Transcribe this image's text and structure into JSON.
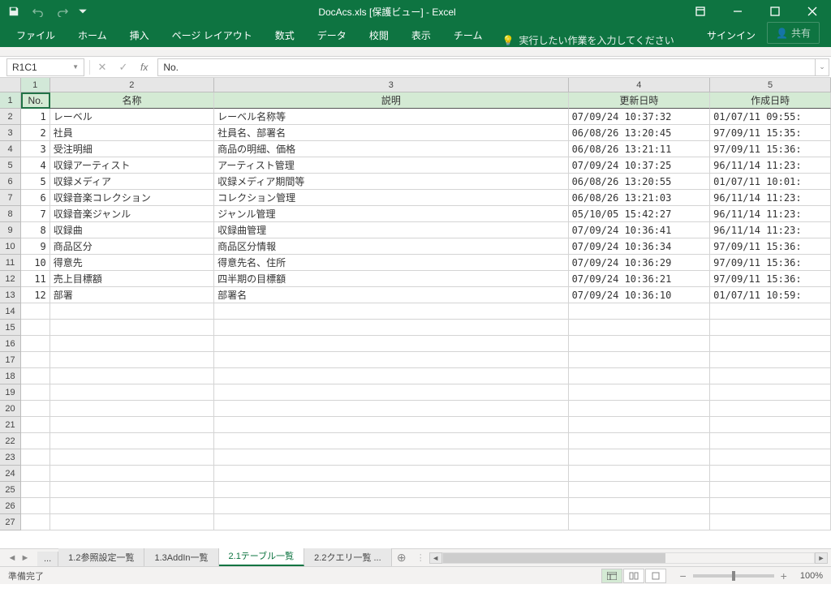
{
  "titlebar": {
    "title": "DocAcs.xls [保護ビュー] - Excel"
  },
  "ribbon": {
    "tabs": [
      "ファイル",
      "ホーム",
      "挿入",
      "ページ レイアウト",
      "数式",
      "データ",
      "校閲",
      "表示",
      "チーム"
    ],
    "tell_me": "実行したい作業を入力してください",
    "signin": "サインイン",
    "share": "共有"
  },
  "formula_bar": {
    "name_box": "R1C1",
    "fx": "fx",
    "value": "No."
  },
  "columns": [
    "1",
    "2",
    "3",
    "4",
    "5"
  ],
  "headers": {
    "c1": "No.",
    "c2": "名称",
    "c3": "説明",
    "c4": "更新日時",
    "c5": "作成日時"
  },
  "rows": [
    {
      "no": "1",
      "name": "レーベル",
      "desc": "レーベル名称等",
      "upd": "07/09/24 10:37:32",
      "crt": "01/07/11 09:55:"
    },
    {
      "no": "2",
      "name": "社員",
      "desc": "社員名、部署名",
      "upd": "06/08/26 13:20:45",
      "crt": "97/09/11 15:35:"
    },
    {
      "no": "3",
      "name": "受注明細",
      "desc": "商品の明細、価格",
      "upd": "06/08/26 13:21:11",
      "crt": "97/09/11 15:36:"
    },
    {
      "no": "4",
      "name": "収録アーティスト",
      "desc": "アーティスト管理",
      "upd": "07/09/24 10:37:25",
      "crt": "96/11/14 11:23:"
    },
    {
      "no": "5",
      "name": "収録メディア",
      "desc": "収録メディア期間等",
      "upd": "06/08/26 13:20:55",
      "crt": "01/07/11 10:01:"
    },
    {
      "no": "6",
      "name": "収録音楽コレクション",
      "desc": "コレクション管理",
      "upd": "06/08/26 13:21:03",
      "crt": "96/11/14 11:23:"
    },
    {
      "no": "7",
      "name": "収録音楽ジャンル",
      "desc": "ジャンル管理",
      "upd": "05/10/05 15:42:27",
      "crt": "96/11/14 11:23:"
    },
    {
      "no": "8",
      "name": "収録曲",
      "desc": "収録曲管理",
      "upd": "07/09/24 10:36:41",
      "crt": "96/11/14 11:23:"
    },
    {
      "no": "9",
      "name": "商品区分",
      "desc": "商品区分情報",
      "upd": "07/09/24 10:36:34",
      "crt": "97/09/11 15:36:"
    },
    {
      "no": "10",
      "name": "得意先",
      "desc": "得意先名、住所",
      "upd": "07/09/24 10:36:29",
      "crt": "97/09/11 15:36:"
    },
    {
      "no": "11",
      "name": "売上目標額",
      "desc": "四半期の目標額",
      "upd": "07/09/24 10:36:21",
      "crt": "97/09/11 15:36:"
    },
    {
      "no": "12",
      "name": "部署",
      "desc": "部署名",
      "upd": "07/09/24 10:36:10",
      "crt": "01/07/11 10:59:"
    }
  ],
  "empty_rows": [
    14,
    15,
    16,
    17,
    18,
    19,
    20,
    21,
    22,
    23,
    24,
    25,
    26,
    27
  ],
  "sheets": {
    "prev_overflow": "...",
    "tabs": [
      {
        "label": "1.2参照設定一覧",
        "active": false
      },
      {
        "label": "1.3AddIn一覧",
        "active": false
      },
      {
        "label": "2.1テーブル一覧",
        "active": true
      },
      {
        "label": "2.2クエリ一覧 ...",
        "active": false
      }
    ]
  },
  "status": {
    "ready": "準備完了",
    "zoom": "100%"
  }
}
